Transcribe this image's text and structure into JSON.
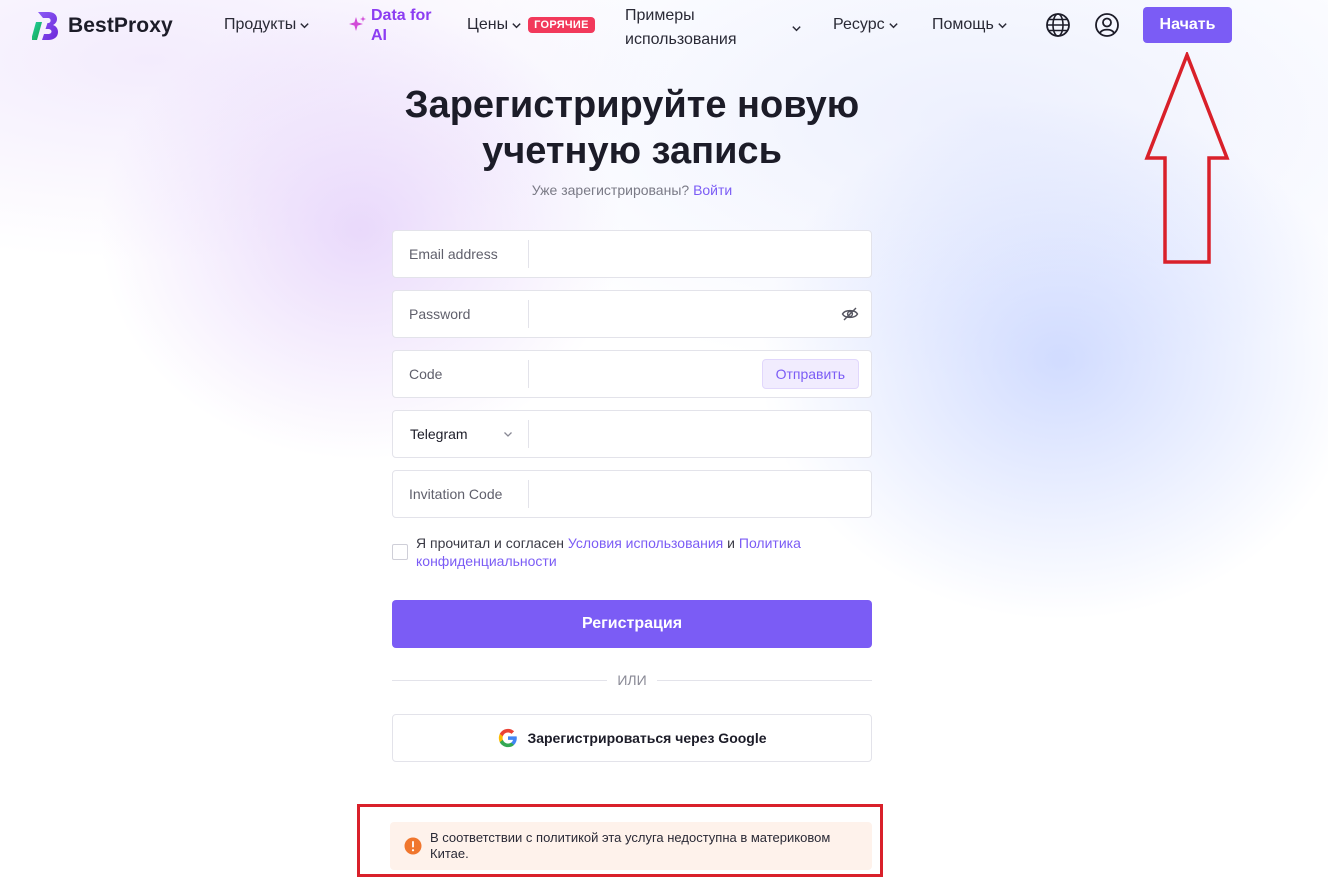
{
  "header": {
    "logo_text": "BestProxy",
    "nav": {
      "products": "Продукты",
      "ai": "Data for AI",
      "prices": "Цены",
      "hot_badge": "ГОРЯЧИЕ",
      "use_cases": "Примеры использования",
      "resource": "Ресурс",
      "help": "Помощь"
    },
    "start_button": "Начать",
    "icons": [
      "globe-icon",
      "user-icon"
    ]
  },
  "main": {
    "title": "Зарегистрируйте новую учетную запись",
    "already_registered": "Уже зарегистрированы?",
    "login_link": "Войти",
    "fields": {
      "email": {
        "label": "Email address",
        "value": ""
      },
      "password": {
        "label": "Password",
        "value": ""
      },
      "code": {
        "label": "Code",
        "value": "",
        "send_button": "Отправить"
      },
      "messenger": {
        "selected": "Telegram",
        "value": ""
      },
      "invitation": {
        "label": "Invitation Code",
        "value": ""
      }
    },
    "agreement": {
      "prefix": "Я прочитал и согласен",
      "terms": "Условия использования",
      "and": "и",
      "privacy": "Политика конфиденциальности",
      "checked": false
    },
    "register_button": "Регистрация",
    "divider_text": "ИЛИ",
    "google_button": "Зарегистрироваться через Google",
    "notice": "В соответствии с политикой эта услуга недоступна в материковом Китае."
  },
  "colors": {
    "accent": "#7b5cf5",
    "ai_link": "#8c3df2",
    "hot_badge": "#f2395b",
    "annotation_red": "#d9202a",
    "notice_bg": "#fef2eb",
    "warning_orange": "#f0762d"
  }
}
